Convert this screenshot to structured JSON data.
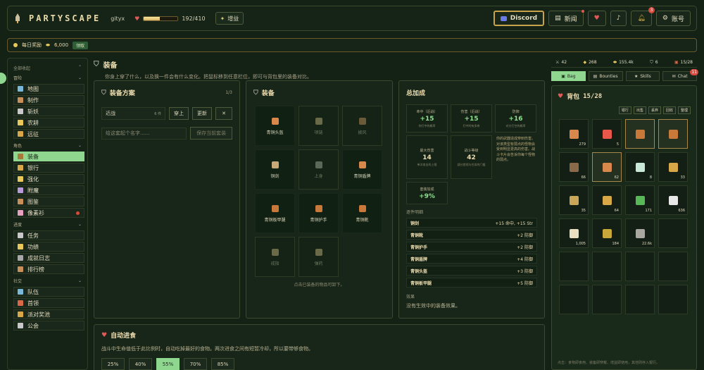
{
  "topbar": {
    "brand": "PARTYSCAPE",
    "username": "gityx",
    "hp_text": "192/410",
    "hp_fraction": 0.468,
    "buff_button": "增益",
    "discord": "Discord",
    "news": "新闻",
    "notif_count": "3",
    "account": "账号"
  },
  "reward_bar": {
    "label": "每日奖励",
    "coins": "6,000",
    "claim": "领取"
  },
  "sidebar": {
    "collapse_all": "全部收起",
    "sections": [
      {
        "title": "冒险",
        "items": [
          {
            "label": "地图",
            "icon_color": "#7ab8d8"
          },
          {
            "label": "制作",
            "icon_color": "#c89058"
          },
          {
            "label": "斩妖",
            "icon_color": "#c8c8c8"
          },
          {
            "label": "农耕",
            "icon_color": "#e8c858"
          },
          {
            "label": "远征",
            "icon_color": "#d8a848"
          }
        ]
      },
      {
        "title": "角色",
        "items": [
          {
            "label": "装备",
            "icon_color": "#a87838",
            "active": true
          },
          {
            "label": "银行",
            "icon_color": "#d8a848"
          },
          {
            "label": "强化",
            "icon_color": "#e8c858"
          },
          {
            "label": "附魔",
            "icon_color": "#b89ad8"
          },
          {
            "label": "图鉴",
            "icon_color": "#c89058"
          },
          {
            "label": "像素衫",
            "icon_color": "#e8a0c0",
            "dot": true
          }
        ]
      },
      {
        "title": "进度",
        "items": [
          {
            "label": "任务",
            "icon_color": "#c8c8c8"
          },
          {
            "label": "功绩",
            "icon_color": "#e8c858"
          },
          {
            "label": "成就日志",
            "icon_color": "#a8a8a8"
          },
          {
            "label": "排行榜",
            "icon_color": "#c89058"
          }
        ]
      },
      {
        "title": "社交",
        "items": [
          {
            "label": "队伍",
            "icon_color": "#7ab8d8"
          },
          {
            "label": "首领",
            "icon_color": "#d86848"
          },
          {
            "label": "派对奖池",
            "icon_color": "#d8a848"
          },
          {
            "label": "公会",
            "icon_color": "#c8c8c8"
          }
        ]
      }
    ]
  },
  "page": {
    "title": "装备",
    "description": "你身上穿了什么，以及换一件会有什么变化。把鼠标移到任意栏位，即可与背包里的装备对比。"
  },
  "loadout": {
    "title": "装备方案",
    "pager": "1/3",
    "preset_name": "近战",
    "preset_count": "6 件",
    "wear": "穿上",
    "update": "更新",
    "delete": "✕",
    "name_placeholder": "给这套起个名字......",
    "save": "保存当前套装"
  },
  "equipment": {
    "title": "装备",
    "slots": [
      {
        "label": "青铜头盔",
        "filled": true,
        "icon_color": "#d8884a"
      },
      {
        "label": "项链",
        "filled": false,
        "icon_color": "#6a6a48"
      },
      {
        "label": "披风",
        "filled": false,
        "icon_color": "#6a5a38"
      },
      {
        "label": "铜剑",
        "filled": true,
        "icon_color": "#c8a878"
      },
      {
        "label": "上身",
        "filled": false,
        "icon_color": "#5a6a58"
      },
      {
        "label": "青铜盾牌",
        "filled": true,
        "icon_color": "#d8884a"
      },
      {
        "label": "青铜板甲腿",
        "filled": true,
        "icon_color": "#c87838"
      },
      {
        "label": "青铜护手",
        "filled": true,
        "icon_color": "#c87838"
      },
      {
        "label": "青铜靴",
        "filled": true,
        "icon_color": "#c87838"
      },
      {
        "label": "戒指",
        "filled": false,
        "icon_color": "#6a6a48"
      },
      {
        "label": "弹药",
        "filled": false,
        "icon_color": "#6a6a48"
      }
    ],
    "hint": "点击已装备的物品可卸下。"
  },
  "bonuses": {
    "title": "总加成",
    "stats": [
      {
        "label": "命中（近战）",
        "value": "+15",
        "desc": "你打中的概率"
      },
      {
        "label": "伤害（近战）",
        "value": "+15",
        "desc": "打中时有多疼"
      },
      {
        "label": "防御",
        "value": "+16",
        "desc": "对方打空的概率"
      }
    ],
    "stats2": [
      {
        "label": "最大伤害",
        "value": "14",
        "desc": "单次攻击的上限"
      },
      {
        "label": "战斗等级",
        "value": "42",
        "desc": "部分首领与任务的门槛"
      }
    ],
    "weapon_note": "你的武器造成穿刺伤害。对该类型有弱点的怪物会受到明显更高的伤害。战斗卡片会告诉你每个怪物的弱点。",
    "set_label": "套装加成",
    "set_value": "+9%",
    "breakdown_title": "逐件明细",
    "breakdown": [
      {
        "name": "铜剑",
        "value": "+15 命中, +15 Str"
      },
      {
        "name": "青铜靴",
        "value": "+2 防御"
      },
      {
        "name": "青铜护手",
        "value": "+2 防御"
      },
      {
        "name": "青铜盾牌",
        "value": "+4 防御"
      },
      {
        "name": "青铜头盔",
        "value": "+3 防御"
      },
      {
        "name": "青铜板甲腿",
        "value": "+5 防御"
      }
    ],
    "effects_title": "效果",
    "effects_empty": "没有生效中的装备效果。"
  },
  "autoeat": {
    "title": "自动进食",
    "desc": "战斗中生命值低于此比例时，自动吃掉最好的食物。两次进食之间有短暂冷却，所以要带够食物。",
    "options": [
      "25%",
      "40%",
      "55%",
      "70%",
      "85%"
    ],
    "selected": "55%"
  },
  "resources": [
    "42",
    "268",
    "155.4k",
    "6",
    "15/28"
  ],
  "right_tabs": [
    {
      "label": "Bag",
      "on": true
    },
    {
      "label": "Bounties"
    },
    {
      "label": "Skills"
    },
    {
      "label": "Chat",
      "badge": "11"
    }
  ],
  "bag": {
    "title": "背包",
    "count": "15/28",
    "buttons": [
      "银行",
      "出售",
      "丢弃",
      "回收",
      "整理"
    ],
    "items": [
      {
        "count": "279",
        "icon_color": "#d8884a",
        "hl": false
      },
      {
        "count": "5",
        "icon_color": "#e8584a",
        "hl": false
      },
      {
        "count": "",
        "icon_color": "#c87838",
        "hl": true
      },
      {
        "count": "",
        "icon_color": "#c87838",
        "hl": true
      },
      {
        "count": "66",
        "icon_color": "#8a6a48",
        "hl": false
      },
      {
        "count": "62",
        "icon_color": "#d8884a",
        "hl": true
      },
      {
        "count": "8",
        "icon_color": "#c8e8d8",
        "hl": false
      },
      {
        "count": "33",
        "icon_color": "#d8a848",
        "hl": false
      },
      {
        "count": "35",
        "icon_color": "#c8a858",
        "hl": false
      },
      {
        "count": "64",
        "icon_color": "#d8a848",
        "hl": false
      },
      {
        "count": "171",
        "icon_color": "#58b858",
        "hl": false
      },
      {
        "count": "636",
        "icon_color": "#e8e8e8",
        "hl": false
      },
      {
        "count": "1,005",
        "icon_color": "#e8e0c0",
        "hl": false
      },
      {
        "count": "184",
        "icon_color": "#c8a838",
        "hl": false
      },
      {
        "count": "22.6k",
        "icon_color": "#a8a8a0",
        "hl": false
      }
    ],
    "footer": "点击：食物即食用、装备即穿戴、增益即使用，其他则存入银行。"
  },
  "colors": {
    "accent": "#8fd68f",
    "gold": "#c9a24c",
    "bg": "#142216"
  }
}
